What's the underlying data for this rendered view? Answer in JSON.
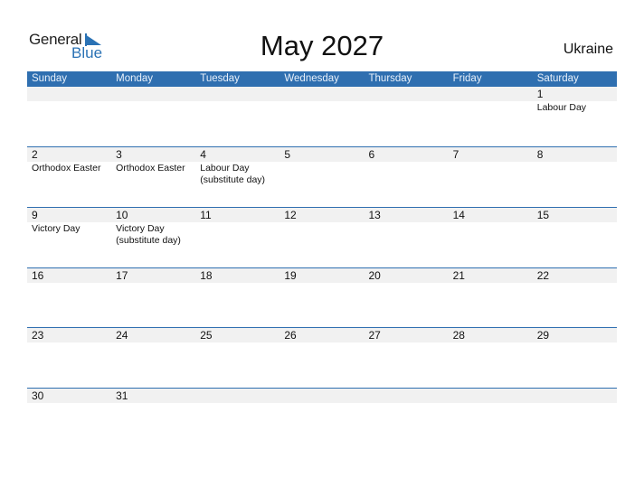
{
  "logo": {
    "word1": "General",
    "word2": "Blue"
  },
  "title": "May 2027",
  "country": "Ukraine",
  "colors": {
    "accent": "#2f6fb0",
    "date_strip": "#f1f1f1"
  },
  "weekdays": [
    "Sunday",
    "Monday",
    "Tuesday",
    "Wednesday",
    "Thursday",
    "Friday",
    "Saturday"
  ],
  "weeks": [
    [
      {
        "d": "",
        "h": ""
      },
      {
        "d": "",
        "h": ""
      },
      {
        "d": "",
        "h": ""
      },
      {
        "d": "",
        "h": ""
      },
      {
        "d": "",
        "h": ""
      },
      {
        "d": "",
        "h": ""
      },
      {
        "d": "1",
        "h": "Labour Day"
      }
    ],
    [
      {
        "d": "2",
        "h": "Orthodox Easter"
      },
      {
        "d": "3",
        "h": "Orthodox Easter"
      },
      {
        "d": "4",
        "h": "Labour Day (substitute day)"
      },
      {
        "d": "5",
        "h": ""
      },
      {
        "d": "6",
        "h": ""
      },
      {
        "d": "7",
        "h": ""
      },
      {
        "d": "8",
        "h": ""
      }
    ],
    [
      {
        "d": "9",
        "h": "Victory Day"
      },
      {
        "d": "10",
        "h": "Victory Day (substitute day)"
      },
      {
        "d": "11",
        "h": ""
      },
      {
        "d": "12",
        "h": ""
      },
      {
        "d": "13",
        "h": ""
      },
      {
        "d": "14",
        "h": ""
      },
      {
        "d": "15",
        "h": ""
      }
    ],
    [
      {
        "d": "16",
        "h": ""
      },
      {
        "d": "17",
        "h": ""
      },
      {
        "d": "18",
        "h": ""
      },
      {
        "d": "19",
        "h": ""
      },
      {
        "d": "20",
        "h": ""
      },
      {
        "d": "21",
        "h": ""
      },
      {
        "d": "22",
        "h": ""
      }
    ],
    [
      {
        "d": "23",
        "h": ""
      },
      {
        "d": "24",
        "h": ""
      },
      {
        "d": "25",
        "h": ""
      },
      {
        "d": "26",
        "h": ""
      },
      {
        "d": "27",
        "h": ""
      },
      {
        "d": "28",
        "h": ""
      },
      {
        "d": "29",
        "h": ""
      }
    ],
    [
      {
        "d": "30",
        "h": ""
      },
      {
        "d": "31",
        "h": ""
      },
      {
        "d": "",
        "h": ""
      },
      {
        "d": "",
        "h": ""
      },
      {
        "d": "",
        "h": ""
      },
      {
        "d": "",
        "h": ""
      },
      {
        "d": "",
        "h": ""
      }
    ]
  ]
}
